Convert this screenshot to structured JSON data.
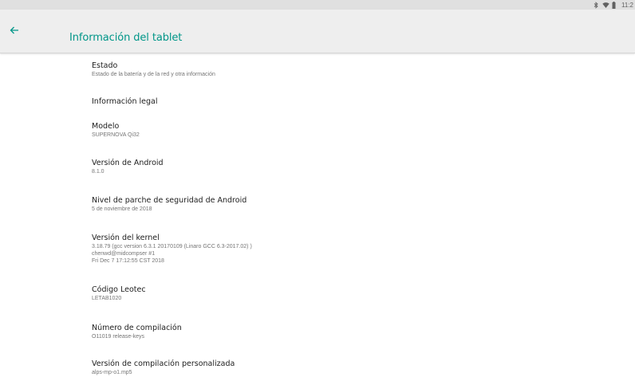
{
  "status_bar": {
    "time": "11:2",
    "icons": [
      "bluetooth-icon",
      "wifi-icon",
      "battery-icon"
    ]
  },
  "toolbar": {
    "back_icon": "arrow-back-icon",
    "title": "Información del tablet",
    "accent_color": "#009688"
  },
  "items": [
    {
      "title": "Estado",
      "summary": [
        "Estado de la batería y de la red y otra información"
      ]
    },
    {
      "title": "Información legal",
      "summary": []
    },
    {
      "title": "Modelo",
      "summary": [
        "SUPERNOVA Qi32"
      ]
    },
    {
      "title": "Versión de Android",
      "summary": [
        "8.1.0"
      ]
    },
    {
      "title": "Nivel de parche de seguridad de Android",
      "summary": [
        "5 de noviembre de 2018"
      ]
    },
    {
      "title": "Versión del kernel",
      "summary": [
        "3.18.79 (gcc version 6.3.1 20170109 (Linaro GCC 6.3-2017.02) )",
        "chenwd@midcompser #1",
        "Fri Dec 7 17:12:55 CST 2018"
      ]
    },
    {
      "title": "Código Leotec",
      "summary": [
        "LETAB1020"
      ]
    },
    {
      "title": "Número de compilación",
      "summary": [
        "O11019 release-keys"
      ]
    },
    {
      "title": "Versión de compilación personalizada",
      "summary": [
        "alps-mp-o1.mp5"
      ]
    }
  ]
}
